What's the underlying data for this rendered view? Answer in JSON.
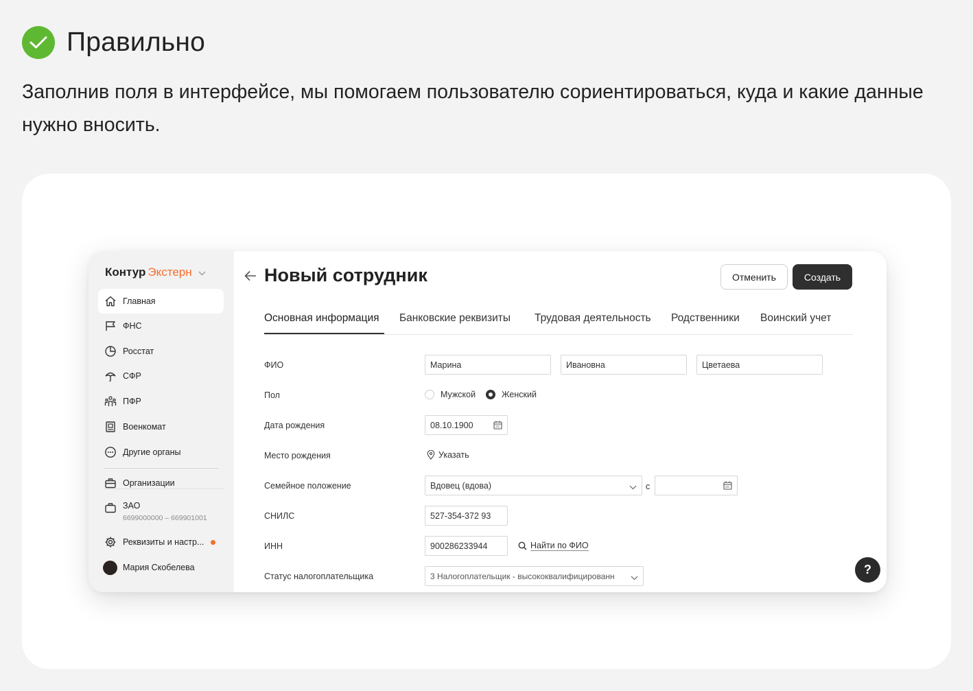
{
  "header": {
    "title": "Правильно",
    "description": "Заполнив поля в интерфейсе, мы помогаем пользователю сориентироваться, куда и какие данные нужно вносить."
  },
  "brand": {
    "name_bold": "Контур",
    "name_accent": "Экстерн",
    "accent_color": "#f36f2c"
  },
  "sidebar": {
    "items": [
      {
        "label": "Главная",
        "icon": "home-icon"
      },
      {
        "label": "ФНС",
        "icon": "flag-icon"
      },
      {
        "label": "Росстат",
        "icon": "pie-chart-icon"
      },
      {
        "label": "СФР",
        "icon": "umbrella-icon"
      },
      {
        "label": "ПФР",
        "icon": "people-icon"
      },
      {
        "label": "Военкомат",
        "icon": "book-icon"
      },
      {
        "label": "Другие органы",
        "icon": "more-circle-icon"
      }
    ],
    "organizations": "Организации",
    "org_name": "ЗАО",
    "org_ids": "6699000000 – 669901001",
    "settings": "Реквизиты и настр...",
    "user": "Мария Скобелева"
  },
  "page": {
    "title": "Новый сотрудник",
    "cancel": "Отменить",
    "create": "Создать"
  },
  "tabs": [
    "Основная информация",
    "Банковские реквизиты",
    "Трудовая деятельность",
    "Родственники",
    "Воинский учет"
  ],
  "form": {
    "fio_label": "ФИО",
    "first_name": "Марина",
    "middle_name": "Ивановна",
    "last_name": "Цветаева",
    "gender_label": "Пол",
    "gender_male": "Мужской",
    "gender_female": "Женский",
    "gender_selected": "Женский",
    "birth_date_label": "Дата рождения",
    "birth_date": "08.10.1900",
    "birth_place_label": "Место рождения",
    "birth_place_action": "Указать",
    "marital_label": "Семейное положение",
    "marital_value": "Вдовец (вдова)",
    "marital_since": "с",
    "snils_label": "СНИЛС",
    "snils": "527-354-372 93",
    "inn_label": "ИНН",
    "inn": "900286233944",
    "inn_action": "Найти по ФИО",
    "tax_status_label": "Статус налогоплательщика",
    "tax_status": "3 Налогоплательщик - высококвалифицированн"
  },
  "help": "?"
}
